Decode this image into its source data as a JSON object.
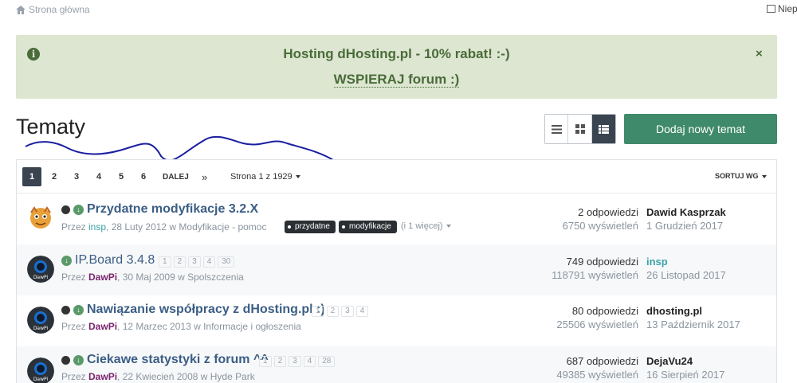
{
  "breadcrumb": {
    "home_label": "Strona główna"
  },
  "topright": {
    "label": "Niep"
  },
  "notice": {
    "line1": "Hosting dHosting.pl - 10% rabat! :-)",
    "line2": "WSPIERAJ forum :)",
    "close": "×"
  },
  "page_title": "Tematy",
  "add_button": "Dodaj nowy temat",
  "pager": {
    "pages": [
      "1",
      "2",
      "3",
      "4",
      "5",
      "6"
    ],
    "next": "DALEJ",
    "last": "»",
    "page_of": "Strona 1 z 1929",
    "sort": "SORTUJ WG"
  },
  "topics": [
    {
      "title": "Przydatne modyfikacje 3.2.X",
      "by": "Przez ",
      "author": "insp",
      "date_cat": ", 28 Luty 2012 w Modyfikacje - pomoc",
      "tags": [
        "przydatne",
        "modyfikacje"
      ],
      "more": "(i 1 więcej)",
      "replies": "2 odpowiedzi",
      "views": "6750 wyświetleń",
      "last_user": "Dawid Kasprzak",
      "last_date": "1 Grudzień 2017"
    },
    {
      "title": "IP.Board 3.4.8",
      "by": "Przez ",
      "author": "DawPi",
      "date_cat": ", 30 Maj 2009 w Spolszczenia",
      "pages": [
        "1",
        "2",
        "3",
        "4",
        "30"
      ],
      "replies": "749 odpowiedzi",
      "views": "118791 wyświetleń",
      "last_user": "insp",
      "last_date": "26 Listopad 2017"
    },
    {
      "title": "Nawiązanie współpracy z dHosting.pl :)",
      "by": "Przez ",
      "author": "DawPi",
      "date_cat": ", 12 Marzec 2013 w Informacje i ogłoszenia",
      "pages": [
        "1",
        "2",
        "3",
        "4"
      ],
      "replies": "80 odpowiedzi",
      "views": "25506 wyświetleń",
      "last_user": "dhosting.pl",
      "last_date": "13 Październik 2017"
    },
    {
      "title": "Ciekawe statystyki z forum ^^",
      "by": "Przez ",
      "author": "DawPi",
      "date_cat": ", 22 Kwiecień 2008 w Hyde Park",
      "pages": [
        "1",
        "2",
        "3",
        "4",
        "28"
      ],
      "replies": "687 odpowiedzi",
      "views": "49385 wyświetleń",
      "last_user": "DejaVu24",
      "last_date": "16 Sierpień 2017"
    }
  ],
  "colors": {
    "accent": "#3f8a6a",
    "notice_bg": "#dce6d0",
    "title_link": "#3b5e85"
  }
}
